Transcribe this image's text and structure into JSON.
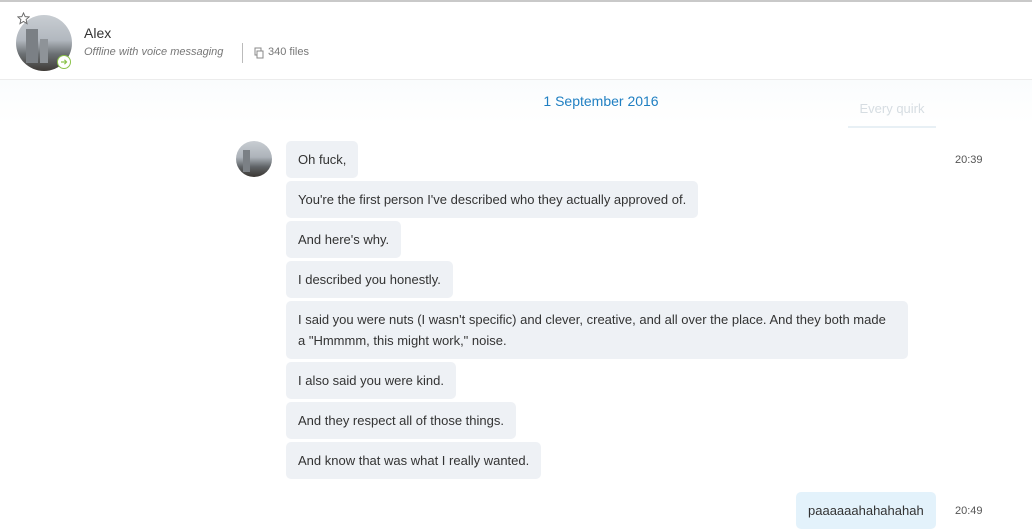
{
  "contact": {
    "name": "Alex",
    "status": "Offline with voice messaging",
    "files": "340 files"
  },
  "date_header": "1 September 2016",
  "ghost_tab": "Every quirk",
  "messages": [
    {
      "text": "Oh fuck,",
      "time": "20:39"
    },
    {
      "text": "You're the first person I've described who they actually approved of."
    },
    {
      "text": "And here's why."
    },
    {
      "text": "I described you honestly."
    },
    {
      "text": "I said you were nuts (I wasn't specific) and clever, creative, and all over the place. And they both made a \"Hmmmm, this might work,\" noise."
    },
    {
      "text": "I also said you were kind."
    },
    {
      "text": "And they respect all of those things."
    },
    {
      "text": "And know that was what I really wanted."
    }
  ],
  "outgoing": {
    "text": "paaaaaahahahahah",
    "time": "20:49"
  },
  "icons": {
    "star": "star-icon",
    "status": "status-arrow-icon",
    "files": "file-stack-icon"
  },
  "colors": {
    "accent": "#1f7fc2",
    "incoming_bubble": "#eef1f5",
    "outgoing_bubble": "#e3f2fb",
    "online_ring": "#8bc34a"
  }
}
